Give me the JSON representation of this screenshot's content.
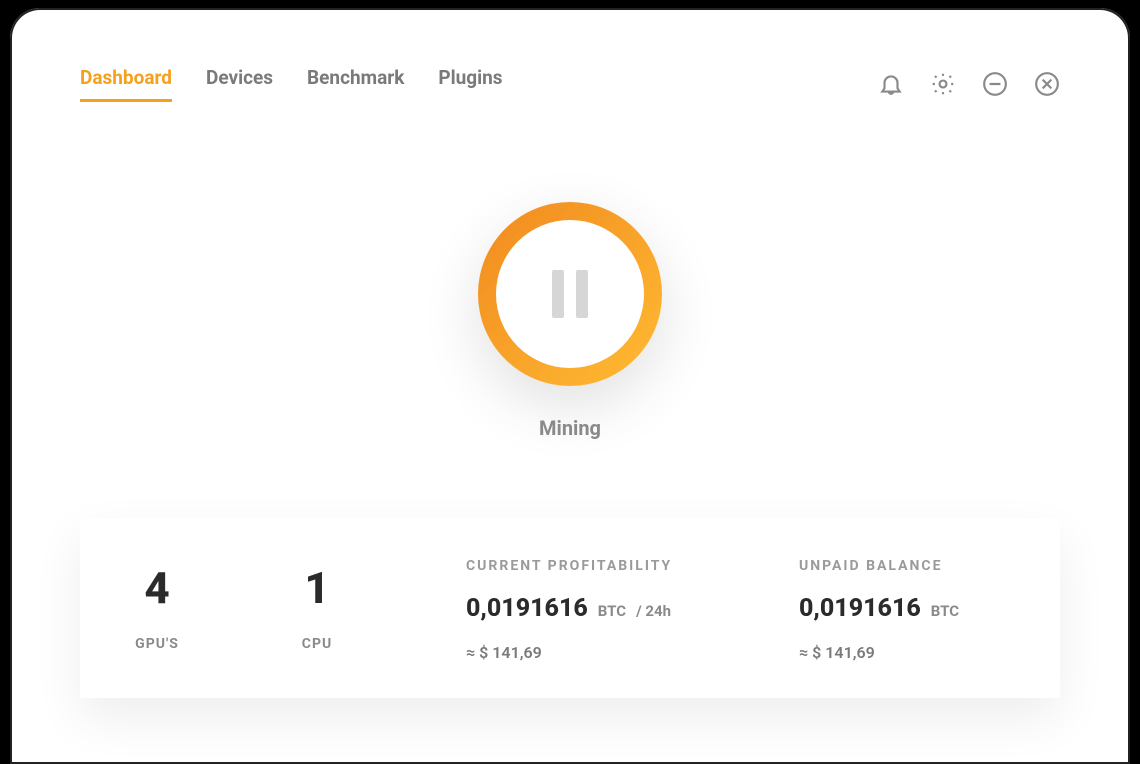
{
  "nav": {
    "tabs": [
      "Dashboard",
      "Devices",
      "Benchmark",
      "Plugins"
    ],
    "active_index": 0
  },
  "mining": {
    "status_label": "Mining",
    "state": "running"
  },
  "stats": {
    "gpu": {
      "value": "4",
      "label": "GPU'S"
    },
    "cpu": {
      "value": "1",
      "label": "CPU"
    },
    "profitability": {
      "caption": "CURRENT PROFITABILITY",
      "amount": "0,0191616",
      "unit": "BTC",
      "period": "/ 24h",
      "approx": "≈ $ 141,69"
    },
    "balance": {
      "caption": "UNPAID BALANCE",
      "amount": "0,0191616",
      "unit": "BTC",
      "approx": "≈ $ 141,69"
    }
  },
  "colors": {
    "accent": "#f7a01e"
  }
}
